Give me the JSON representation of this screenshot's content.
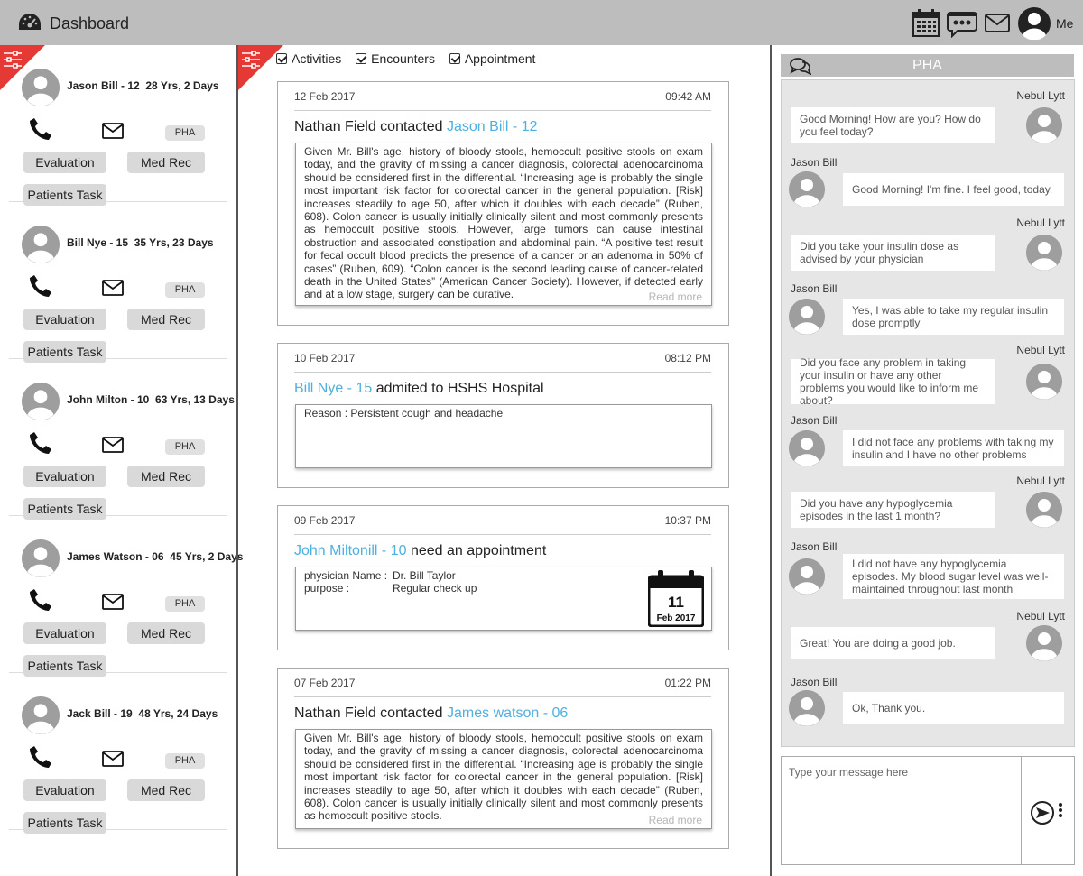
{
  "header": {
    "title": "Dashboard",
    "me_label": "Me"
  },
  "patients": [
    {
      "name": "Jason Bill - 12",
      "age": "28 Yrs, 2 Days",
      "pha": "PHA",
      "evaluation": "Evaluation",
      "med_rec": "Med Rec",
      "task": "Patients Task"
    },
    {
      "name": "Bill Nye - 15",
      "age": "35 Yrs, 23 Days",
      "pha": "PHA",
      "evaluation": "Evaluation",
      "med_rec": "Med Rec",
      "task": "Patients Task"
    },
    {
      "name": "John Milton - 10",
      "age": "63 Yrs, 13 Days",
      "pha": "PHA",
      "evaluation": "Evaluation",
      "med_rec": "Med Rec",
      "task": "Patients Task"
    },
    {
      "name": "James Watson - 06",
      "age": "45 Yrs, 2 Days",
      "pha": "PHA",
      "evaluation": "Evaluation",
      "med_rec": "Med Rec",
      "task": "Patients Task"
    },
    {
      "name": "Jack Bill - 19",
      "age": "48 Yrs, 24 Days",
      "pha": "PHA",
      "evaluation": "Evaluation",
      "med_rec": "Med Rec",
      "task": "Patients Task"
    }
  ],
  "filters": {
    "activities": "Activities",
    "encounters": "Encounters",
    "appointment": "Appointment"
  },
  "feed": [
    {
      "date": "12 Feb 2017",
      "time": "09:42 AM",
      "prefix": "Nathan Field contacted ",
      "link": "Jason Bill - 12",
      "suffix": "",
      "body": "Given Mr. Bill's age, history of bloody stools, hemoccult positive stools on exam today, and the gravity of missing a cancer diagnosis, colorectal adenocarcinoma should be considered first in the differential. “Increasing age is probably the single most important risk factor for colorectal cancer in the general population. [Risk] increases steadily to age 50, after which it doubles with each decade” (Ruben, 608). Colon cancer is usually initially clinically silent and most commonly presents as hemoccult positive stools. However, large tumors can cause intestinal obstruction and associated constipation and abdominal pain. “A positive test result for fecal occult blood predicts the presence of a cancer or an adenoma in 50% of cases” (Ruben, 609). “Colon cancer is the second leading cause of cancer-related death in the United States” (American Cancer Society). However, if detected early and at a low stage, surgery can be curative.",
      "read_more": "Read more"
    },
    {
      "date": "10 Feb 2017",
      "time": "08:12 PM",
      "prefix": "",
      "link": "Bill Nye - 15",
      "suffix": " admited to HSHS Hospital",
      "body": "Reason : Persistent cough and headache"
    },
    {
      "date": "09 Feb 2017",
      "time": "10:37 PM",
      "prefix": "",
      "link": "John Miltonill - 10",
      "suffix": " need an appointment",
      "physician_label": "physician Name :",
      "physician_value": "Dr. Bill Taylor",
      "purpose_label": "purpose :",
      "purpose_value": "Regular check up",
      "cal_day": "11",
      "cal_month": "Feb 2017"
    },
    {
      "date": "07 Feb 2017",
      "time": "01:22 PM",
      "prefix": "Nathan Field contacted ",
      "link": "James watson - 06",
      "suffix": "",
      "body": "Given Mr. Bill's age, history of bloody stools, hemoccult positive stools on exam today, and the gravity of missing a cancer diagnosis, colorectal adenocarcinoma should be considered first in the differential. “Increasing age is probably the single most important risk factor for colorectal cancer in the general population. [Risk] increases steadily to age 50, after which it doubles with each decade” (Ruben, 608). Colon cancer is usually initially clinically silent and most commonly presents as hemoccult positive stools.",
      "read_more": "Read more"
    }
  ],
  "chat": {
    "title": "PHA",
    "messages": [
      {
        "sender": "Nebul Lytt",
        "text": "Good Morning! How are you? How do you feel today?"
      },
      {
        "sender": "Jason Bill",
        "text": "Good Morning! I'm fine. I feel good, today."
      },
      {
        "sender": "Nebul Lytt",
        "text": "Did you take your insulin dose as advised by your physician"
      },
      {
        "sender": "Jason Bill",
        "text": "Yes, I was able to take my regular insulin dose promptly"
      },
      {
        "sender": "Nebul Lytt",
        "text": "Did you face any problem in taking your insulin or have any other problems you would like to inform me about?"
      },
      {
        "sender": "Jason Bill",
        "text": "I did not face any problems with taking my insulin and I have no other problems"
      },
      {
        "sender": "Nebul Lytt",
        "text": "Did you have any hypoglycemia episodes in the last 1 month?"
      },
      {
        "sender": "Jason Bill",
        "text": "I did not have any hypoglycemia episodes. My blood sugar level was well-maintained throughout last month"
      },
      {
        "sender": "Nebul Lytt",
        "text": "Great! You are doing a good job."
      },
      {
        "sender": "Jason Bill",
        "text": "Ok, Thank you."
      }
    ],
    "placeholder": "Type your message here"
  }
}
